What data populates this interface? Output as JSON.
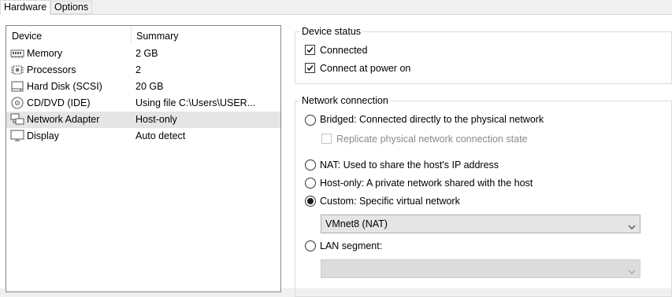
{
  "tabs": [
    {
      "label": "Hardware",
      "active": true
    },
    {
      "label": "Options",
      "active": false
    }
  ],
  "device_list": {
    "columns": {
      "device": "Device",
      "summary": "Summary"
    },
    "rows": [
      {
        "name": "Memory",
        "summary": "2 GB",
        "icon": "memory-icon"
      },
      {
        "name": "Processors",
        "summary": "2",
        "icon": "processor-icon"
      },
      {
        "name": "Hard Disk (SCSI)",
        "summary": "20 GB",
        "icon": "hard-disk-icon"
      },
      {
        "name": "CD/DVD (IDE)",
        "summary": "Using file C:\\Users\\USER...",
        "icon": "cd-dvd-icon"
      },
      {
        "name": "Network Adapter",
        "summary": "Host-only",
        "icon": "network-adapter-icon",
        "selected": true
      },
      {
        "name": "Display",
        "summary": "Auto detect",
        "icon": "display-icon"
      }
    ]
  },
  "device_status": {
    "title": "Device status",
    "connected": {
      "label": "Connected",
      "checked": true
    },
    "connect_at_power_on": {
      "label": "Connect at power on",
      "checked": true
    }
  },
  "network_connection": {
    "title": "Network connection",
    "bridged": {
      "label": "Bridged: Connected directly to the physical network",
      "selected": false
    },
    "replicate": {
      "label": "Replicate physical network connection state",
      "checked": false,
      "enabled": false
    },
    "nat": {
      "label": "NAT: Used to share the host's IP address",
      "selected": false
    },
    "host_only": {
      "label": "Host-only: A private network shared with the host",
      "selected": false
    },
    "custom": {
      "label": "Custom: Specific virtual network",
      "selected": true
    },
    "custom_network": {
      "value": "VMnet8 (NAT)"
    },
    "lan_segment": {
      "label": "LAN segment:",
      "selected": false
    },
    "lan_segment_select": {
      "value": ""
    }
  },
  "colors": {
    "selected_row": "#e5e5e5",
    "window_bg": "#ffffff",
    "tab_bg": "#f0f0f0"
  }
}
